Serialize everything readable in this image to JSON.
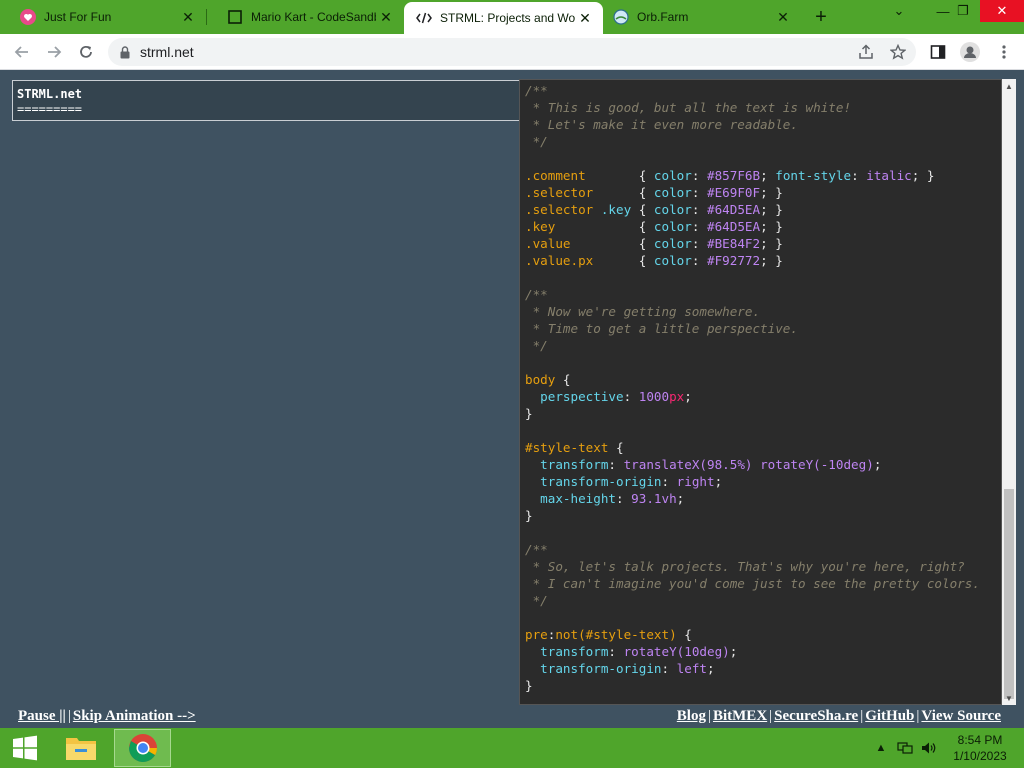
{
  "tabs": [
    {
      "title": "Just For Fun",
      "icon": "heart-icon"
    },
    {
      "title": "Mario Kart - CodeSandbox",
      "icon": "codesandbox-icon"
    },
    {
      "title": "STRML: Projects and Work",
      "icon": "code-icon",
      "active": true
    },
    {
      "title": "Orb.Farm",
      "icon": "orb-farm-icon"
    }
  ],
  "toolbar": {
    "url": "strml.net"
  },
  "heading": {
    "title": "STRML.net",
    "underline": "========="
  },
  "style_text": [
    [
      [
        "c",
        "/**"
      ]
    ],
    [
      [
        "c",
        " * This is good, but all the text is white!"
      ]
    ],
    [
      [
        "c",
        " * Let's make it even more readable."
      ]
    ],
    [
      [
        "c",
        " */"
      ]
    ],
    [],
    [
      [
        "s",
        ".comment       "
      ],
      [
        "p",
        "{ "
      ],
      [
        "k",
        "color"
      ],
      [
        "p",
        ": "
      ],
      [
        "v",
        "#857F6B"
      ],
      [
        "p",
        "; "
      ],
      [
        "k",
        "font-style"
      ],
      [
        "p",
        ": "
      ],
      [
        "v",
        "italic"
      ],
      [
        "p",
        "; }"
      ]
    ],
    [
      [
        "s",
        ".selector      "
      ],
      [
        "p",
        "{ "
      ],
      [
        "k",
        "color"
      ],
      [
        "p",
        ": "
      ],
      [
        "v",
        "#E69F0F"
      ],
      [
        "p",
        "; }"
      ]
    ],
    [
      [
        "s",
        ".selector "
      ],
      [
        "k",
        ".key"
      ],
      [
        "p",
        " { "
      ],
      [
        "k",
        "color"
      ],
      [
        "p",
        ": "
      ],
      [
        "v",
        "#64D5EA"
      ],
      [
        "p",
        "; }"
      ]
    ],
    [
      [
        "s",
        ".key           "
      ],
      [
        "p",
        "{ "
      ],
      [
        "k",
        "color"
      ],
      [
        "p",
        ": "
      ],
      [
        "v",
        "#64D5EA"
      ],
      [
        "p",
        "; }"
      ]
    ],
    [
      [
        "s",
        ".value         "
      ],
      [
        "p",
        "{ "
      ],
      [
        "k",
        "color"
      ],
      [
        "p",
        ": "
      ],
      [
        "v",
        "#BE84F2"
      ],
      [
        "p",
        "; }"
      ]
    ],
    [
      [
        "s",
        ".value.px      "
      ],
      [
        "p",
        "{ "
      ],
      [
        "k",
        "color"
      ],
      [
        "p",
        ": "
      ],
      [
        "v",
        "#F92772"
      ],
      [
        "p",
        "; }"
      ]
    ],
    [],
    [
      [
        "c",
        "/**"
      ]
    ],
    [
      [
        "c",
        " * Now we're getting somewhere."
      ]
    ],
    [
      [
        "c",
        " * Time to get a little perspective."
      ]
    ],
    [
      [
        "c",
        " */"
      ]
    ],
    [],
    [
      [
        "s",
        "body"
      ],
      [
        "p",
        " {"
      ]
    ],
    [
      [
        "p",
        "  "
      ],
      [
        "k",
        "perspective"
      ],
      [
        "p",
        ": "
      ],
      [
        "v",
        "1000"
      ],
      [
        "px",
        "px"
      ],
      [
        "p",
        ";"
      ]
    ],
    [
      [
        "p",
        "}"
      ]
    ],
    [],
    [
      [
        "s",
        "#style-text"
      ],
      [
        "p",
        " {"
      ]
    ],
    [
      [
        "p",
        "  "
      ],
      [
        "k",
        "transform"
      ],
      [
        "p",
        ": "
      ],
      [
        "v",
        "translateX(98.5%) rotateY(-10deg)"
      ],
      [
        "p",
        ";"
      ]
    ],
    [
      [
        "p",
        "  "
      ],
      [
        "k",
        "transform-origin"
      ],
      [
        "p",
        ": "
      ],
      [
        "v",
        "right"
      ],
      [
        "p",
        ";"
      ]
    ],
    [
      [
        "p",
        "  "
      ],
      [
        "k",
        "max-height"
      ],
      [
        "p",
        ": "
      ],
      [
        "v",
        "93.1vh"
      ],
      [
        "p",
        ";"
      ]
    ],
    [
      [
        "p",
        "}"
      ]
    ],
    [],
    [
      [
        "c",
        "/**"
      ]
    ],
    [
      [
        "c",
        " * So, let's talk projects. That's why you're here, right?"
      ]
    ],
    [
      [
        "c",
        " * I can't imagine you'd come just to see the pretty colors."
      ]
    ],
    [
      [
        "c",
        " */"
      ]
    ],
    [],
    [
      [
        "s",
        "pre"
      ],
      [
        "p",
        ":"
      ],
      [
        "s",
        "not(#style-text)"
      ],
      [
        "p",
        " {"
      ]
    ],
    [
      [
        "p",
        "  "
      ],
      [
        "k",
        "transform"
      ],
      [
        "p",
        ": "
      ],
      [
        "v",
        "rotateY(10deg)"
      ],
      [
        "p",
        ";"
      ]
    ],
    [
      [
        "p",
        "  "
      ],
      [
        "k",
        "transform-origin"
      ],
      [
        "p",
        ": "
      ],
      [
        "v",
        "left"
      ],
      [
        "p",
        ";"
      ]
    ],
    [
      [
        "p",
        "}"
      ]
    ]
  ],
  "footer": {
    "pause": "Pause ||",
    "skip": "Skip Animation -->",
    "links": [
      "Blog",
      "BitMEX",
      "SecureSha.re",
      "GitHub",
      "View Source"
    ]
  },
  "taskbar": {
    "time": "8:54 PM",
    "date": "1/10/2023"
  },
  "colors": {
    "tabstrip": "#4fa52b",
    "page_bg": "#3f5261",
    "code_bg": "#2b2b2b"
  }
}
